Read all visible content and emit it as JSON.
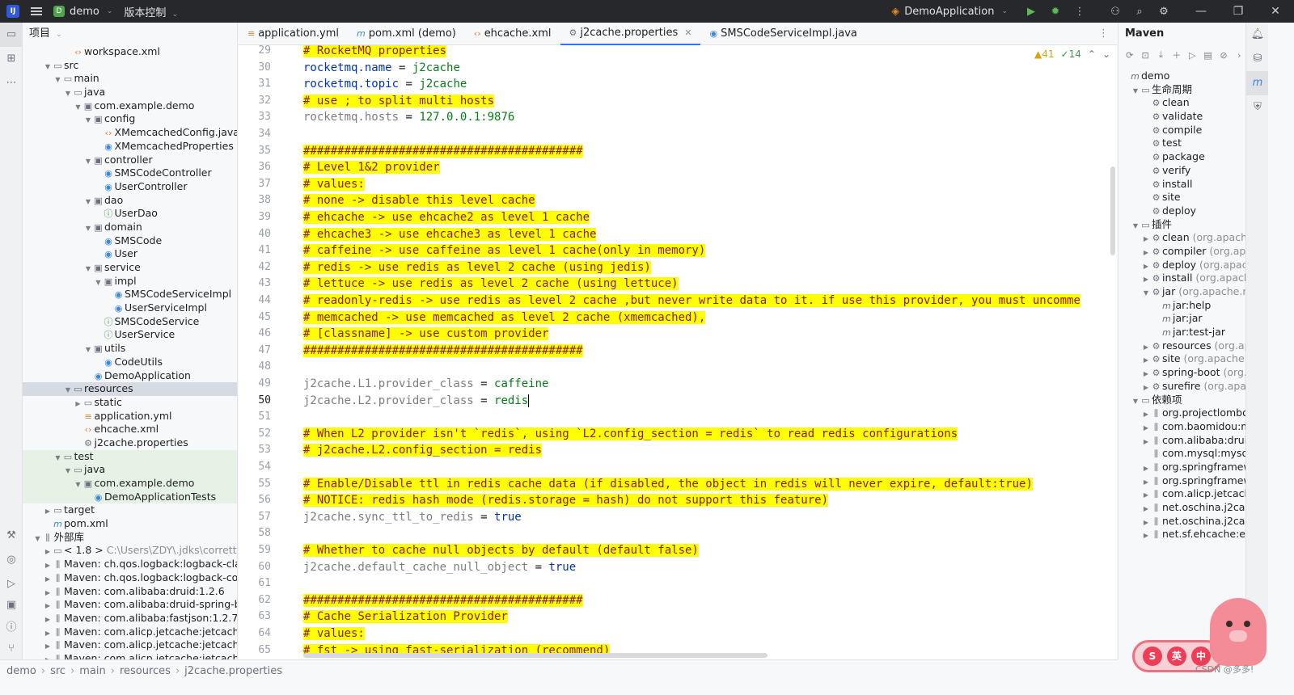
{
  "titlebar": {
    "project": "demo",
    "project_badge": "D",
    "vcs": "版本控制",
    "run_config": "DemoApplication"
  },
  "project_panel": {
    "title": "项目",
    "rows": [
      {
        "depth": 4,
        "tw": "",
        "icon": "xml",
        "label": "workspace.xml",
        "suffix": ""
      },
      {
        "depth": 2,
        "tw": "v",
        "icon": "folder",
        "label": "src",
        "suffix": ""
      },
      {
        "depth": 3,
        "tw": "v",
        "icon": "folder",
        "label": "main",
        "suffix": ""
      },
      {
        "depth": 4,
        "tw": "v",
        "icon": "folder",
        "label": "java",
        "suffix": ""
      },
      {
        "depth": 5,
        "tw": "v",
        "icon": "pkg",
        "label": "com.example.demo",
        "suffix": ""
      },
      {
        "depth": 6,
        "tw": "v",
        "icon": "pkg",
        "label": "config",
        "suffix": ""
      },
      {
        "depth": 7,
        "tw": "",
        "icon": "xml",
        "label": "XMemcachedConfig.java",
        "suffix": ""
      },
      {
        "depth": 7,
        "tw": "",
        "icon": "class",
        "label": "XMemcachedProperties",
        "suffix": ""
      },
      {
        "depth": 6,
        "tw": "v",
        "icon": "pkg",
        "label": "controller",
        "suffix": ""
      },
      {
        "depth": 7,
        "tw": "",
        "icon": "class",
        "label": "SMSCodeController",
        "suffix": ""
      },
      {
        "depth": 7,
        "tw": "",
        "icon": "class",
        "label": "UserController",
        "suffix": ""
      },
      {
        "depth": 6,
        "tw": "v",
        "icon": "pkg",
        "label": "dao",
        "suffix": ""
      },
      {
        "depth": 7,
        "tw": "",
        "icon": "iface",
        "label": "UserDao",
        "suffix": ""
      },
      {
        "depth": 6,
        "tw": "v",
        "icon": "pkg",
        "label": "domain",
        "suffix": ""
      },
      {
        "depth": 7,
        "tw": "",
        "icon": "class",
        "label": "SMSCode",
        "suffix": ""
      },
      {
        "depth": 7,
        "tw": "",
        "icon": "class",
        "label": "User",
        "suffix": ""
      },
      {
        "depth": 6,
        "tw": "v",
        "icon": "pkg",
        "label": "service",
        "suffix": ""
      },
      {
        "depth": 7,
        "tw": "v",
        "icon": "pkg",
        "label": "impl",
        "suffix": ""
      },
      {
        "depth": 8,
        "tw": "",
        "icon": "class",
        "label": "SMSCodeServiceImpl",
        "suffix": ""
      },
      {
        "depth": 8,
        "tw": "",
        "icon": "class",
        "label": "UserServiceImpl",
        "suffix": ""
      },
      {
        "depth": 7,
        "tw": "",
        "icon": "iface",
        "label": "SMSCodeService",
        "suffix": ""
      },
      {
        "depth": 7,
        "tw": "",
        "icon": "iface",
        "label": "UserService",
        "suffix": ""
      },
      {
        "depth": 6,
        "tw": "v",
        "icon": "pkg",
        "label": "utils",
        "suffix": ""
      },
      {
        "depth": 7,
        "tw": "",
        "icon": "class",
        "label": "CodeUtils",
        "suffix": ""
      },
      {
        "depth": 6,
        "tw": "",
        "icon": "class",
        "label": "DemoApplication",
        "suffix": ""
      },
      {
        "depth": 4,
        "tw": "v",
        "icon": "folder",
        "label": "resources",
        "suffix": "",
        "selected": true
      },
      {
        "depth": 5,
        "tw": ">",
        "icon": "folder",
        "label": "static",
        "suffix": ""
      },
      {
        "depth": 5,
        "tw": "",
        "icon": "yml",
        "label": "application.yml",
        "suffix": ""
      },
      {
        "depth": 5,
        "tw": "",
        "icon": "xml",
        "label": "ehcache.xml",
        "suffix": ""
      },
      {
        "depth": 5,
        "tw": "",
        "icon": "props",
        "label": "j2cache.properties",
        "suffix": ""
      },
      {
        "depth": 3,
        "tw": "v",
        "icon": "folder",
        "label": "test",
        "suffix": "",
        "test": true
      },
      {
        "depth": 4,
        "tw": "v",
        "icon": "folder",
        "label": "java",
        "suffix": "",
        "test": true
      },
      {
        "depth": 5,
        "tw": "v",
        "icon": "pkg",
        "label": "com.example.demo",
        "suffix": "",
        "test": true
      },
      {
        "depth": 6,
        "tw": "",
        "icon": "class",
        "label": "DemoApplicationTests",
        "suffix": "",
        "test": true
      },
      {
        "depth": 2,
        "tw": ">",
        "icon": "folder",
        "label": "target",
        "suffix": ""
      },
      {
        "depth": 2,
        "tw": "",
        "icon": "maven",
        "label": "pom.xml",
        "suffix": ""
      },
      {
        "depth": 1,
        "tw": "v",
        "icon": "lib",
        "label": "外部库",
        "suffix": ""
      },
      {
        "depth": 2,
        "tw": ">",
        "icon": "folder",
        "label": "< 1.8 >",
        "suffix": " C:\\Users\\ZDY\\.jdks\\corretto"
      },
      {
        "depth": 2,
        "tw": ">",
        "icon": "lib",
        "label": "Maven: ch.qos.logback:logback-clas",
        "suffix": ""
      },
      {
        "depth": 2,
        "tw": ">",
        "icon": "lib",
        "label": "Maven: ch.qos.logback:logback-cor",
        "suffix": ""
      },
      {
        "depth": 2,
        "tw": ">",
        "icon": "lib",
        "label": "Maven: com.alibaba:druid:1.2.6",
        "suffix": ""
      },
      {
        "depth": 2,
        "tw": ">",
        "icon": "lib",
        "label": "Maven: com.alibaba:druid-spring-bo",
        "suffix": ""
      },
      {
        "depth": 2,
        "tw": ">",
        "icon": "lib",
        "label": "Maven: com.alibaba:fastjson:1.2.76",
        "suffix": ""
      },
      {
        "depth": 2,
        "tw": ">",
        "icon": "lib",
        "label": "Maven: com.alicp.jetcache:jetcache",
        "suffix": ""
      },
      {
        "depth": 2,
        "tw": ">",
        "icon": "lib",
        "label": "Maven: com.alicp.jetcache:jetcache",
        "suffix": ""
      },
      {
        "depth": 2,
        "tw": ">",
        "icon": "lib",
        "label": "Maven: com.alicp.jetcache:jetcache",
        "suffix": ""
      }
    ]
  },
  "tabs": [
    {
      "label": "application.yml",
      "icon": "yml",
      "active": false
    },
    {
      "label": "pom.xml (demo)",
      "icon": "maven",
      "active": false
    },
    {
      "label": "ehcache.xml",
      "icon": "xml",
      "active": false
    },
    {
      "label": "j2cache.properties",
      "icon": "props",
      "active": true
    },
    {
      "label": "SMSCodeServiceImpl.java",
      "icon": "class",
      "active": false
    }
  ],
  "editor": {
    "warnings": "▲41",
    "checks": "✓14",
    "current_line": 50,
    "lines": [
      {
        "n": 29,
        "type": "hl",
        "text": "# RocketMQ properties"
      },
      {
        "n": 30,
        "type": "kv",
        "key": "rocketmq.name",
        "value": "j2cache"
      },
      {
        "n": 31,
        "type": "kv",
        "key": "rocketmq.topic",
        "value": "j2cache"
      },
      {
        "n": 32,
        "type": "hl",
        "text": "# use ; to split multi hosts"
      },
      {
        "n": 33,
        "type": "kvg",
        "key": "rocketmq.hosts",
        "value": "127.0.0.1:9876"
      },
      {
        "n": 34,
        "type": "blank",
        "text": ""
      },
      {
        "n": 35,
        "type": "hl",
        "text": "#########################################"
      },
      {
        "n": 36,
        "type": "hl",
        "text": "# Level 1&2 provider"
      },
      {
        "n": 37,
        "type": "hl",
        "text": "# values:"
      },
      {
        "n": 38,
        "type": "hl",
        "text": "# none -> disable this level cache"
      },
      {
        "n": 39,
        "type": "hl",
        "text": "# ehcache -> use ehcache2 as level 1 cache"
      },
      {
        "n": 40,
        "type": "hl",
        "text": "# ehcache3 -> use ehcache3 as level 1 cache"
      },
      {
        "n": 41,
        "type": "hl",
        "text": "# caffeine -> use caffeine as level 1 cache(only in memory)"
      },
      {
        "n": 42,
        "type": "hl",
        "text": "# redis -> use redis as level 2 cache (using jedis)"
      },
      {
        "n": 43,
        "type": "hl",
        "text": "# lettuce -> use redis as level 2 cache (using lettuce)"
      },
      {
        "n": 44,
        "type": "hl",
        "text": "# readonly-redis -> use redis as level 2 cache ,but never write data to it. if use this provider, you must uncomme"
      },
      {
        "n": 45,
        "type": "hl",
        "text": "# memcached -> use memcached as level 2 cache (xmemcached),"
      },
      {
        "n": 46,
        "type": "hl",
        "text": "# [classname] -> use custom provider"
      },
      {
        "n": 47,
        "type": "hl",
        "text": "#########################################"
      },
      {
        "n": 48,
        "type": "blank",
        "text": ""
      },
      {
        "n": 49,
        "type": "kvg",
        "key": "j2cache.L1.provider_class",
        "value": "caffeine"
      },
      {
        "n": 50,
        "type": "kvg",
        "key": "j2cache.L2.provider_class",
        "value": "redis",
        "caret": true
      },
      {
        "n": 51,
        "type": "blank",
        "text": ""
      },
      {
        "n": 52,
        "type": "hl",
        "text": "# When L2 provider isn't `redis`, using `L2.config_section = redis` to read redis configurations"
      },
      {
        "n": 53,
        "type": "hl",
        "text": "# j2cache.L2.config_section = redis"
      },
      {
        "n": 54,
        "type": "blank",
        "text": ""
      },
      {
        "n": 55,
        "type": "hl",
        "text": "# Enable/Disable ttl in redis cache data (if disabled, the object in redis will never expire, default:true)"
      },
      {
        "n": 56,
        "type": "hl",
        "text": "# NOTICE: redis hash mode (redis.storage = hash) do not support this feature)"
      },
      {
        "n": 57,
        "type": "kvg",
        "key": "j2cache.sync_ttl_to_redis",
        "value": "true",
        "vk": true
      },
      {
        "n": 58,
        "type": "blank",
        "text": ""
      },
      {
        "n": 59,
        "type": "hl",
        "text": "# Whether to cache null objects by default (default false)"
      },
      {
        "n": 60,
        "type": "kvg",
        "key": "j2cache.default_cache_null_object",
        "value": "true",
        "vk": true
      },
      {
        "n": 61,
        "type": "blank",
        "text": ""
      },
      {
        "n": 62,
        "type": "hl",
        "text": "#########################################"
      },
      {
        "n": 63,
        "type": "hl",
        "text": "# Cache Serialization Provider"
      },
      {
        "n": 64,
        "type": "hl",
        "text": "# values:"
      },
      {
        "n": 65,
        "type": "hl",
        "text": "# fst -> using fast-serialization (recommend)"
      }
    ]
  },
  "maven": {
    "title": "Maven",
    "rows": [
      {
        "depth": 0,
        "tw": "",
        "icon": "maven",
        "label": "demo",
        "suffix": ""
      },
      {
        "depth": 1,
        "tw": "v",
        "icon": "folder",
        "label": "生命周期",
        "suffix": ""
      },
      {
        "depth": 2,
        "tw": "",
        "icon": "gear",
        "label": "clean",
        "suffix": ""
      },
      {
        "depth": 2,
        "tw": "",
        "icon": "gear",
        "label": "validate",
        "suffix": ""
      },
      {
        "depth": 2,
        "tw": "",
        "icon": "gear",
        "label": "compile",
        "suffix": ""
      },
      {
        "depth": 2,
        "tw": "",
        "icon": "gear",
        "label": "test",
        "suffix": ""
      },
      {
        "depth": 2,
        "tw": "",
        "icon": "gear",
        "label": "package",
        "suffix": ""
      },
      {
        "depth": 2,
        "tw": "",
        "icon": "gear",
        "label": "verify",
        "suffix": ""
      },
      {
        "depth": 2,
        "tw": "",
        "icon": "gear",
        "label": "install",
        "suffix": ""
      },
      {
        "depth": 2,
        "tw": "",
        "icon": "gear",
        "label": "site",
        "suffix": ""
      },
      {
        "depth": 2,
        "tw": "",
        "icon": "gear",
        "label": "deploy",
        "suffix": ""
      },
      {
        "depth": 1,
        "tw": "v",
        "icon": "folder",
        "label": "插件",
        "suffix": ""
      },
      {
        "depth": 2,
        "tw": ">",
        "icon": "plugin",
        "label": "clean",
        "suffix": " (org.apache."
      },
      {
        "depth": 2,
        "tw": ">",
        "icon": "plugin",
        "label": "compiler",
        "suffix": " (org.apac"
      },
      {
        "depth": 2,
        "tw": ">",
        "icon": "plugin",
        "label": "deploy",
        "suffix": " (org.apache"
      },
      {
        "depth": 2,
        "tw": ">",
        "icon": "plugin",
        "label": "install",
        "suffix": " (org.apache."
      },
      {
        "depth": 2,
        "tw": "v",
        "icon": "plugin",
        "label": "jar",
        "suffix": " (org.apache.ma"
      },
      {
        "depth": 3,
        "tw": "",
        "icon": "maven",
        "label": "jar:help",
        "suffix": ""
      },
      {
        "depth": 3,
        "tw": "",
        "icon": "maven",
        "label": "jar:jar",
        "suffix": ""
      },
      {
        "depth": 3,
        "tw": "",
        "icon": "maven",
        "label": "jar:test-jar",
        "suffix": ""
      },
      {
        "depth": 2,
        "tw": ">",
        "icon": "plugin",
        "label": "resources",
        "suffix": " (org.apa"
      },
      {
        "depth": 2,
        "tw": ">",
        "icon": "plugin",
        "label": "site",
        "suffix": " (org.apache.m"
      },
      {
        "depth": 2,
        "tw": ">",
        "icon": "plugin",
        "label": "spring-boot",
        "suffix": " (org.s"
      },
      {
        "depth": 2,
        "tw": ">",
        "icon": "plugin",
        "label": "surefire",
        "suffix": " (org.apach"
      },
      {
        "depth": 1,
        "tw": "v",
        "icon": "folder",
        "label": "依赖项",
        "suffix": ""
      },
      {
        "depth": 2,
        "tw": ">",
        "icon": "lib",
        "label": "org.projectlombok:",
        "suffix": ""
      },
      {
        "depth": 2,
        "tw": ">",
        "icon": "lib",
        "label": "com.baomidou:myb",
        "suffix": ""
      },
      {
        "depth": 2,
        "tw": ">",
        "icon": "lib",
        "label": "com.alibaba:druid-s",
        "suffix": ""
      },
      {
        "depth": 2,
        "tw": "",
        "icon": "lib",
        "label": "com.mysql:mysql-c",
        "suffix": ""
      },
      {
        "depth": 2,
        "tw": ">",
        "icon": "lib",
        "label": "org.springframewo",
        "suffix": ""
      },
      {
        "depth": 2,
        "tw": ">",
        "icon": "lib",
        "label": "org.springframewo",
        "suffix": ""
      },
      {
        "depth": 2,
        "tw": ">",
        "icon": "lib",
        "label": "com.alicp.jetcache:",
        "suffix": ""
      },
      {
        "depth": 2,
        "tw": ">",
        "icon": "lib",
        "label": "net.oschina.j2cach",
        "suffix": ""
      },
      {
        "depth": 2,
        "tw": ">",
        "icon": "lib",
        "label": "net.oschina.j2cach",
        "suffix": ""
      },
      {
        "depth": 2,
        "tw": ">",
        "icon": "lib",
        "label": "net.sf.ehcache:eh",
        "suffix": ""
      }
    ]
  },
  "statusbar": {
    "breadcrumb": [
      "demo",
      "src",
      "main",
      "resources",
      "j2cache.properties"
    ]
  },
  "overlay": {
    "badge_1": "S",
    "badge_2": "英",
    "badge_3": "中",
    "watermark": "CSDN @多多!"
  },
  "colors": {
    "highlight": "#ffff00",
    "accent": "#3574f0"
  }
}
